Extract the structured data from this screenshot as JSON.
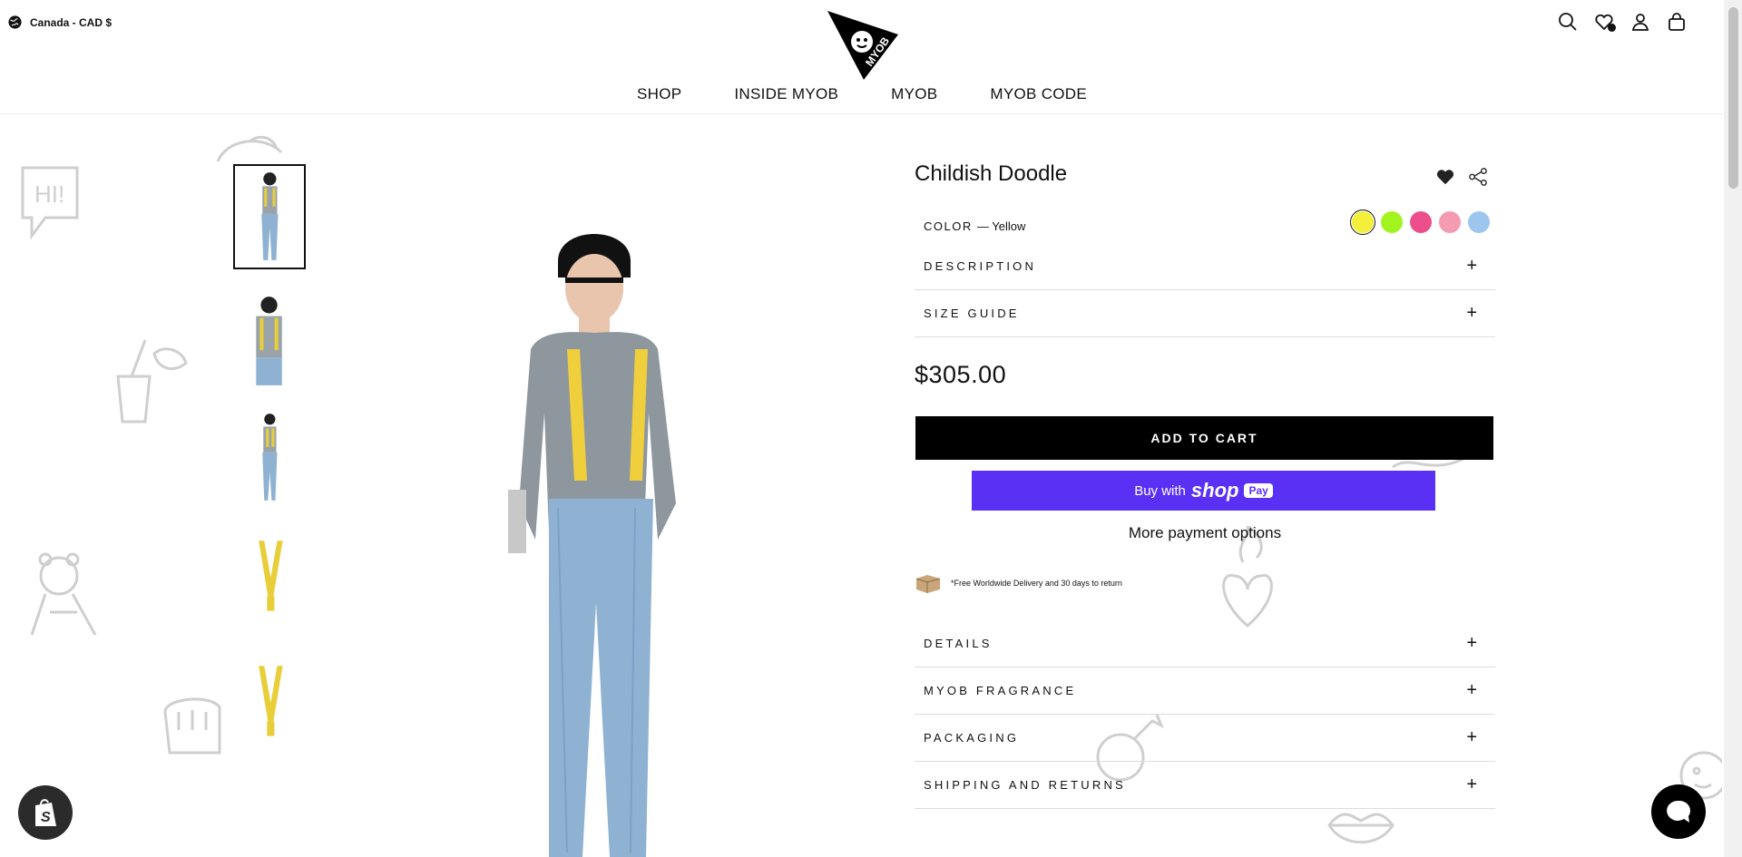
{
  "header": {
    "locale": "Canada - CAD $",
    "logo_text": "MYOB",
    "nav": [
      "SHOP",
      "INSIDE MYOB",
      "MYOB",
      "MYOB CODE"
    ],
    "icons": [
      "search-icon",
      "wishlist-icon",
      "account-icon",
      "bag-icon"
    ]
  },
  "gallery": {
    "thumbnail_count": 5,
    "active_thumbnail": 1
  },
  "product": {
    "title": "Childish Doodle",
    "color_label": "COLOR",
    "color_value": "— Yellow",
    "swatches": [
      "#f4f03a",
      "#a2f41f",
      "#ec4e8c",
      "#f49bb1",
      "#9dc6ef"
    ],
    "selected_swatch": 0,
    "accordion_top": [
      "DESCRIPTION",
      "SIZE GUIDE"
    ],
    "price": "$305.00",
    "add_to_cart": "ADD TO CART",
    "shop_pay_prefix": "Buy with",
    "shop_pay_logo": "shop",
    "shop_pay_badge": "Pay",
    "more_payment": "More payment options",
    "delivery_note": "*Free Worldwide Delivery and 30 days to return",
    "accordion_bottom": [
      "DETAILS",
      "MYOB FRAGRANCE",
      "PACKAGING",
      "SHIPPING AND RETURNS"
    ],
    "plus_symbol": "+"
  },
  "colors": {
    "cart_button": "#000000",
    "shop_pay": "#5a31f4",
    "doodle_stroke": "#cfcfcf"
  }
}
